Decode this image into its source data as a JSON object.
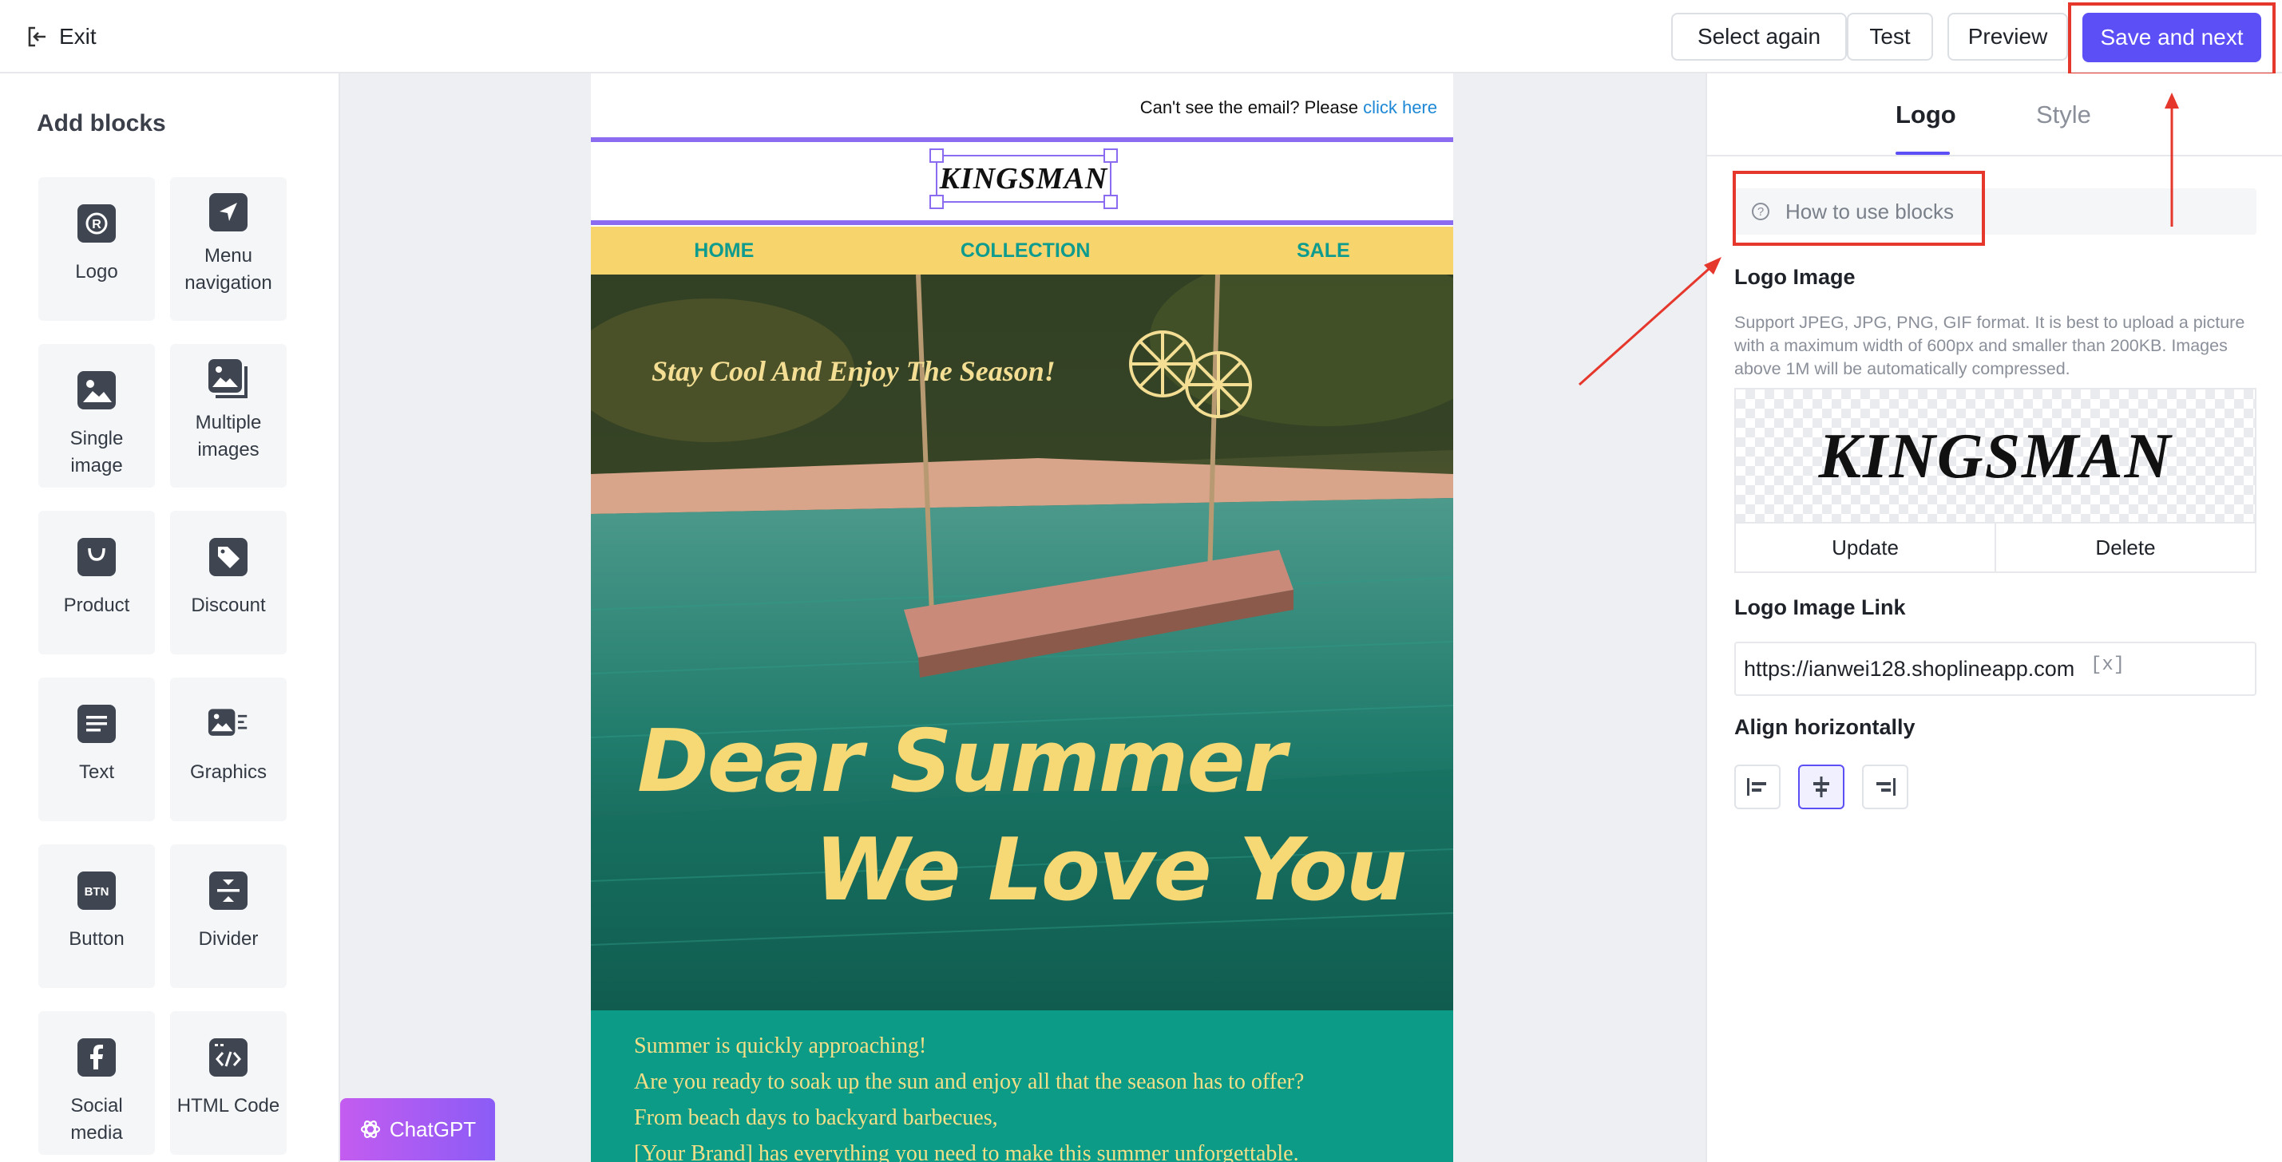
{
  "topbar": {
    "exit_label": "Exit",
    "select_again_label": "Select again",
    "test_label": "Test",
    "preview_label": "Preview",
    "save_next_label": "Save and next"
  },
  "sidebar": {
    "title": "Add blocks",
    "blocks": [
      {
        "label": "Logo",
        "icon": "logo-icon"
      },
      {
        "label": "Menu navigation",
        "icon": "navigation-arrow-icon"
      },
      {
        "label": "Single image",
        "icon": "image-icon"
      },
      {
        "label": "Multiple images",
        "icon": "multiple-images-icon"
      },
      {
        "label": "Product",
        "icon": "shopping-bag-icon"
      },
      {
        "label": "Discount",
        "icon": "tag-icon"
      },
      {
        "label": "Text",
        "icon": "text-icon"
      },
      {
        "label": "Graphics",
        "icon": "graphics-icon"
      },
      {
        "label": "Button",
        "icon": "button-icon"
      },
      {
        "label": "Divider",
        "icon": "divider-icon"
      },
      {
        "label": "Social media",
        "icon": "facebook-icon"
      },
      {
        "label": "HTML Code",
        "icon": "code-icon"
      }
    ],
    "button_icon_text": "BTN"
  },
  "email": {
    "preheader_text": "Can't see the email? Please ",
    "preheader_link": "click here",
    "logo_text": "KINGSMAN",
    "nav": [
      "HOME",
      "COLLECTION",
      "SALE"
    ],
    "hero_tagline": "Stay Cool And Enjoy The Season!",
    "hero_line1": "Dear Summer",
    "hero_line2": "We Love You",
    "copy_lines": [
      "Summer is quickly approaching!",
      "Are you ready to soak up the sun and enjoy all that the season has to offer?",
      "From beach days to backyard barbecues,",
      "[Your Brand] has everything you need to make this summer unforgettable."
    ]
  },
  "chatgpt_label": "ChatGPT",
  "settings": {
    "tabs": [
      "Logo",
      "Style"
    ],
    "active_tab": "Logo",
    "howto_label": "How to use blocks",
    "logo_image_label": "Logo Image",
    "logo_help": "Support JPEG, JPG, PNG, GIF format. It is best to upload a picture with a maximum width of 600px and smaller than 200KB. Images above 1M will be automatically compressed.",
    "preview_logo_text": "KINGSMAN",
    "update_label": "Update",
    "delete_label": "Delete",
    "logo_link_label": "Logo Image Link",
    "logo_link_value": "https://ianwei128.shoplineapp.com",
    "clear_label": "[x]",
    "align_label": "Align horizontally",
    "align_options": [
      "left",
      "center",
      "right"
    ],
    "align_selected": "center"
  },
  "colors": {
    "accent": "#5b4ff5",
    "selection": "#8b6cf0",
    "annotation": "#e5372c",
    "nav_bg": "#f7d46c",
    "nav_text": "#0f9b8e",
    "copy_bg": "#0b9b87"
  }
}
